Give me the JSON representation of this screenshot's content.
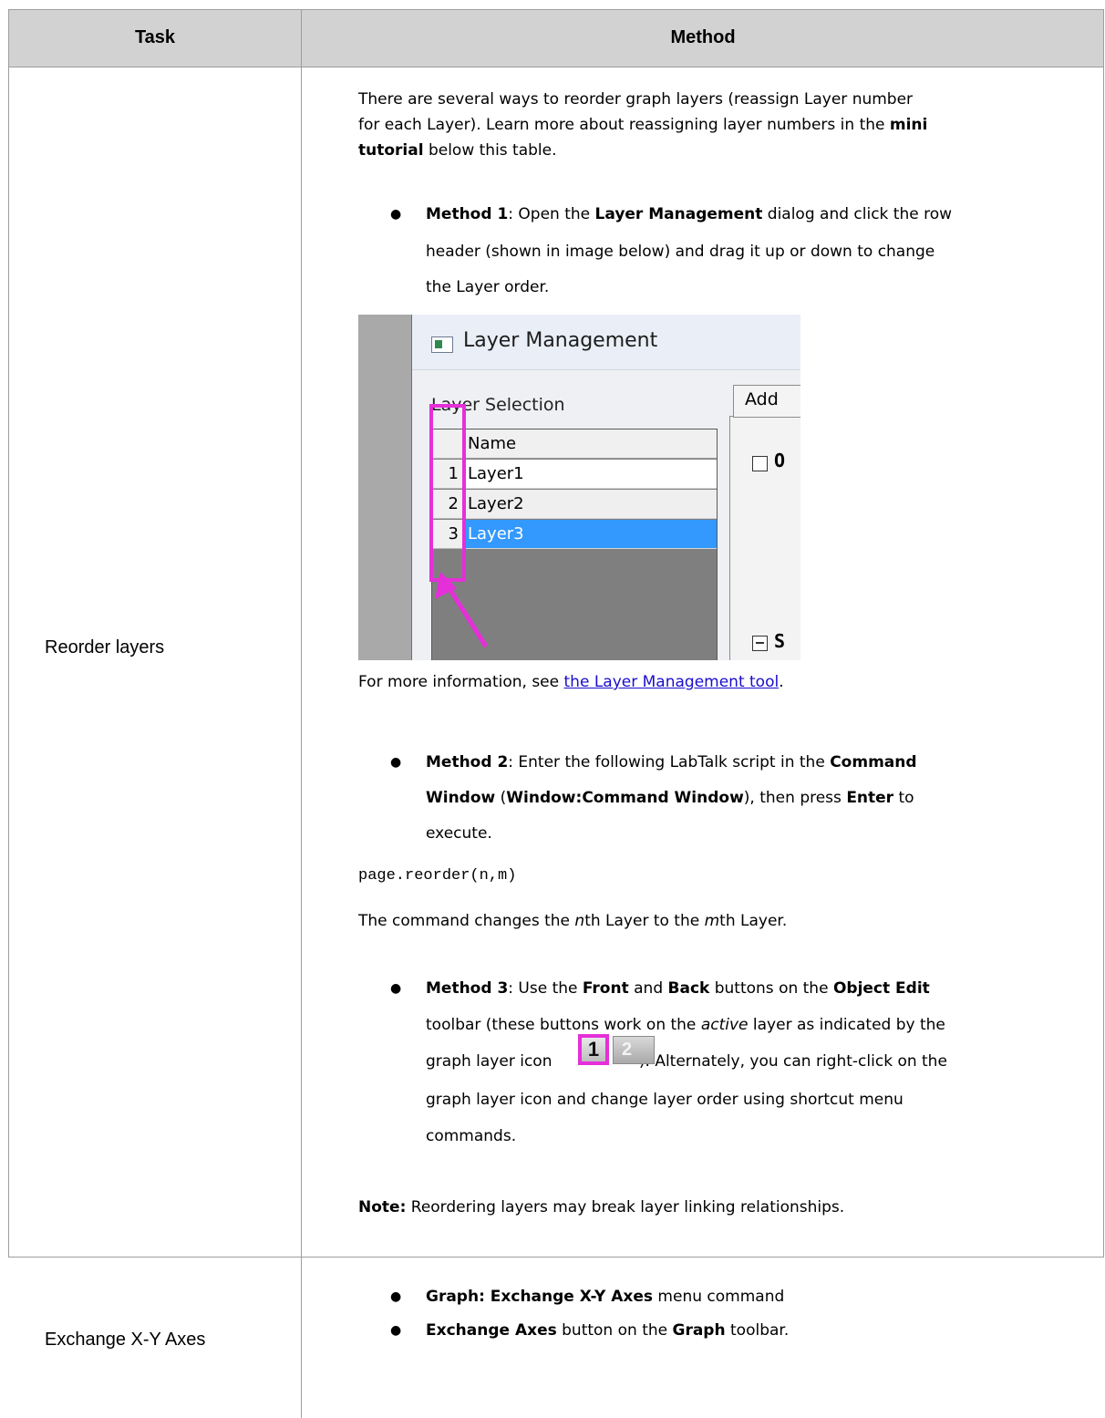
{
  "table": {
    "headers": {
      "task": "Task",
      "method": "Method"
    },
    "rows": [
      {
        "task": "Reorder layers",
        "intro": [
          {
            "t": "There are several ways to reorder graph layers (reassign Layer number"
          },
          {
            "t": "for each Layer). Learn more about reassigning layer numbers in the "
          },
          {
            "b": "mini"
          },
          {
            "b": "tutorial"
          },
          {
            "t": " below this table."
          }
        ],
        "method1": {
          "label": "Method 1",
          "l1a": ": Open the ",
          "l1b": "Layer Management",
          "l1c": " dialog and click the row",
          "l2": "header (shown in image below) and drag it up or down to change",
          "l3": "the Layer order."
        },
        "screenshot": {
          "window_title": "Layer Management",
          "layer_selection": "Layer Selection",
          "add_tab": "Add",
          "grid_header": "Name",
          "rows": [
            {
              "num": "1",
              "name": "Layer1"
            },
            {
              "num": "2",
              "name": "Layer2"
            },
            {
              "num": "3",
              "name": "Layer3"
            }
          ],
          "cb1_text": "O",
          "cb2_text": "S",
          "highlight_color": "#e52fd9",
          "selected_color": "#3399ff"
        },
        "more_info_prefix": "For more information, see ",
        "more_info_link": "the Layer Management tool",
        "more_info_suffix": ".",
        "method2": {
          "label": "Method 2",
          "l1a": ": Enter the following LabTalk script in the ",
          "l1b": "Command",
          "l2a": "Window",
          "l2b": " (",
          "l2c": "Window:Command Window",
          "l2d": "), then press ",
          "l2e": "Enter",
          "l2f": " to",
          "l3": "execute."
        },
        "code": "page.reorder(n,m)",
        "command_desc": {
          "a": "The command changes the ",
          "n": "n",
          "b": "th Layer to the ",
          "m": "m",
          "c": "th Layer."
        },
        "method3": {
          "label": "Method 3",
          "l1a": ": Use the ",
          "l1b": "Front",
          "l1c": " and ",
          "l1d": "Back",
          "l1e": " buttons on the ",
          "l1f": "Object Edit",
          "l2a": "toolbar (these buttons work on the ",
          "l2b": "active",
          "l2c": " layer as indicated by the",
          "l3a": "graph layer icon ",
          "l3b": "). Alternately, you can right-click on the",
          "l4": "graph layer icon and change layer order using shortcut menu",
          "l5": "commands.",
          "icon_labels": [
            "1",
            "2"
          ]
        },
        "note": {
          "label": "Note:",
          "text": " Reordering layers may break layer linking relationships."
        }
      },
      {
        "task": "Exchange X-Y Axes",
        "bullets": [
          {
            "b": "Graph: Exchange X-Y Axes",
            "t": " menu command"
          },
          {
            "b": "Exchange Axes",
            "t": " button on the ",
            "b2": "Graph",
            "t2": " toolbar."
          }
        ]
      }
    ]
  },
  "colors": {
    "header_bg": "#d2d2d2",
    "border": "#9e9e9e",
    "link": "#1a0dcc"
  }
}
